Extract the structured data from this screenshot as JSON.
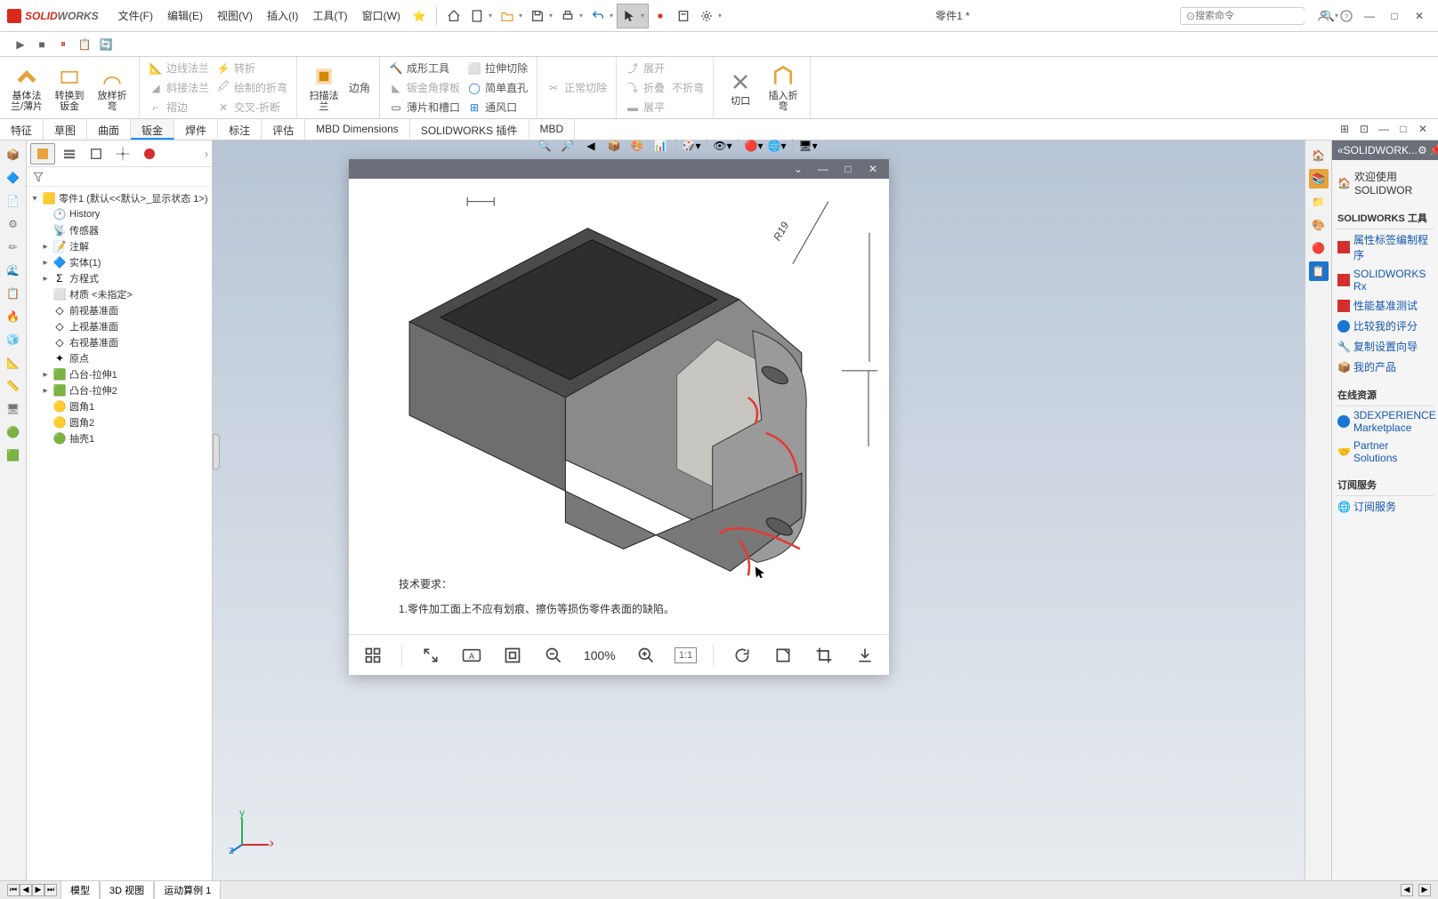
{
  "app": {
    "brand1": "SOLID",
    "brand2": "WORKS"
  },
  "menu": {
    "file": "文件(F)",
    "edit": "编辑(E)",
    "view": "视图(V)",
    "insert": "插入(I)",
    "tools": "工具(T)",
    "window": "窗口(W)"
  },
  "doc_title": "零件1 *",
  "search_placeholder": "搜索命令",
  "ribbon": {
    "g1": {
      "a": "基体法\n兰/薄片",
      "b": "转换到\n钣金",
      "c": "放样折\n弯"
    },
    "g2": {
      "a": "边线法兰",
      "b": "斜接法兰",
      "c": "褶边",
      "d": "转折",
      "e": "绘制的折弯",
      "f": "交叉-折断"
    },
    "g3": {
      "a": "扫描法\n兰",
      "b": "边角"
    },
    "g4": {
      "a": "成形工具",
      "b": "钣金角撑板",
      "c": "薄片和槽口",
      "d": "拉伸切除",
      "e": "简单直孔",
      "f": "通风口"
    },
    "g5": {
      "a": "正常切除"
    },
    "g6": {
      "a": "展开",
      "b": "折叠",
      "c": "不折弯",
      "d": "展平"
    },
    "g7": {
      "a": "切口",
      "b": "插入折\n弯"
    }
  },
  "tabs": {
    "t1": "特征",
    "t2": "草图",
    "t3": "曲面",
    "t4": "钣金",
    "t5": "焊件",
    "t6": "标注",
    "t7": "评估",
    "t8": "MBD Dimensions",
    "t9": "SOLIDWORKS 插件",
    "t10": "MBD"
  },
  "tree": {
    "root": "零件1  (默认<<默认>_显示状态 1>)",
    "history": "History",
    "sensors": "传感器",
    "annotations": "注解",
    "solid": "实体(1)",
    "equations": "方程式",
    "material": "材质 <未指定>",
    "front": "前视基准面",
    "top": "上视基准面",
    "right": "右视基准面",
    "origin": "原点",
    "boss1": "凸台-拉伸1",
    "boss2": "凸台-拉伸2",
    "fillet1": "圆角1",
    "fillet2": "圆角2",
    "shell1": "抽壳1"
  },
  "viewer": {
    "zoom": "100%",
    "ratio": "1:1",
    "note_title": "技术要求：",
    "note_1": "1.零件加工面上不应有划痕、擦伤等损伤零件表面的缺陷。",
    "radius": "R19"
  },
  "taskpane": {
    "header": "«SOLIDWORK...",
    "welcome": "欢迎使用  SOLIDWOR",
    "tools_title": "SOLIDWORKS 工具",
    "t1": "属性标签编制程序",
    "t2": "SOLIDWORKS Rx",
    "t3": "性能基准测试",
    "t4": "比较我的评分",
    "t5": "复制设置向导",
    "t6": "我的产品",
    "online_title": "在线资源",
    "o1": "3DEXPERIENCE\nMarketplace",
    "o2": "Partner Solutions",
    "sub_title": "订阅服务",
    "s1": "订阅服务"
  },
  "status": {
    "model": "模型",
    "view3d": "3D 视图",
    "motion": "运动算例 1"
  }
}
